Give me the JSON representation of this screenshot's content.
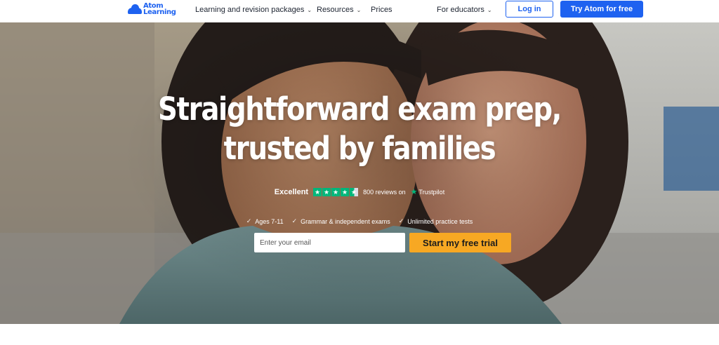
{
  "brand": {
    "logo_line1": "Atom",
    "logo_line2": "Learning",
    "primary_color": "#1e62f0"
  },
  "nav": {
    "items": [
      {
        "label": "Learning and revision packages",
        "dropdown": true
      },
      {
        "label": "Resources",
        "dropdown": true
      },
      {
        "label": "Prices",
        "dropdown": false
      },
      {
        "label": "For educators",
        "dropdown": true
      }
    ],
    "login_label": "Log in",
    "try_label": "Try Atom for free"
  },
  "hero": {
    "headline_line1": "Straightforward exam prep,",
    "headline_line2": "trusted by families",
    "rating_label": "Excellent",
    "stars": 4.5,
    "star_color": "#00b67a",
    "reviews_text": "800 reviews on",
    "review_site": "Trustpilot",
    "features": [
      "Ages 7-11",
      "Grammar & independent exams",
      "Unlimited practice tests"
    ],
    "email_placeholder": "Enter your email",
    "cta_label": "Start my free trial",
    "cta_color": "#f7a823"
  }
}
